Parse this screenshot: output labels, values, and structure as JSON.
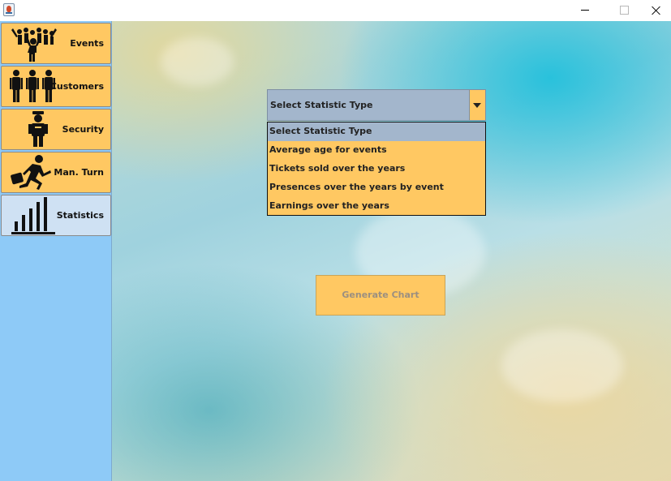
{
  "window": {
    "icons": {
      "app": "java-cup-icon",
      "minimize": "minimize-icon",
      "maximize": "maximize-icon",
      "close": "close-icon"
    }
  },
  "sidebar": {
    "items": [
      {
        "label": "Events",
        "icon": "crowd-icon",
        "active": false
      },
      {
        "label": "Customers",
        "icon": "people-icon",
        "active": false
      },
      {
        "label": "Security",
        "icon": "security-guard-icon",
        "active": false
      },
      {
        "label": "Man. Turn",
        "icon": "running-man-icon",
        "active": false
      },
      {
        "label": "Statistics",
        "icon": "bar-chart-icon",
        "active": true
      }
    ]
  },
  "statistics": {
    "combo": {
      "selected": "Select Statistic Type",
      "options": [
        "Select Statistic Type",
        "Average age for events",
        "Tickets sold over the years",
        "Presences over the years by event",
        "Earnings over the years"
      ]
    },
    "generate_label": "Generate Chart"
  },
  "colors": {
    "accent": "#ffc862",
    "sidebar_bg": "#8ecaf7",
    "active_tab": "#cfe1f3",
    "combo_selected": "#a3b6cc"
  }
}
